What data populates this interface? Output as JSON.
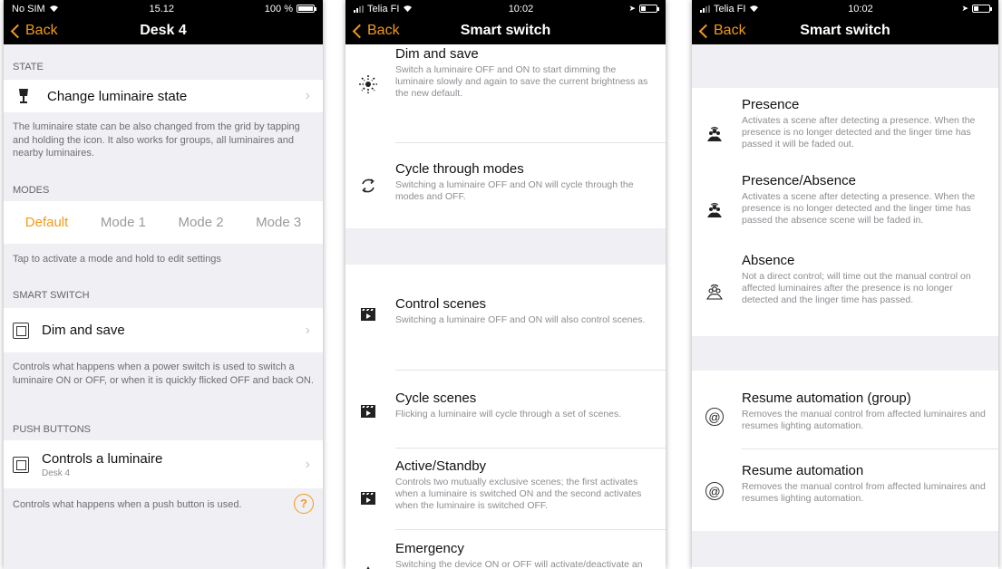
{
  "panel1": {
    "status": {
      "carrier": "No SIM",
      "time": "15.12",
      "battery": "100 %"
    },
    "nav": {
      "back": "Back",
      "title": "Desk 4"
    },
    "state_header": "STATE",
    "state_cell": "Change luminaire state",
    "state_note": "The luminaire state can be also changed from the grid by tapping and holding the icon. It also works for groups, all luminaires and nearby luminaires.",
    "modes_header": "MODES",
    "modes": [
      "Default",
      "Mode 1",
      "Mode 2",
      "Mode 3"
    ],
    "modes_note": "Tap to activate a mode and hold to edit settings",
    "smart_header": "SMART SWITCH",
    "smart_cell": "Dim and save",
    "smart_note": "Controls what happens when a power switch is used to switch a luminaire ON or OFF, or when it is quickly flicked OFF and back ON.",
    "push_header": "PUSH BUTTONS",
    "push_cell": "Controls a luminaire",
    "push_sub": "Desk 4",
    "push_note": "Controls what happens when a push button is used.",
    "help": "?"
  },
  "panel2": {
    "status": {
      "carrier": "Telia FI",
      "time": "10:02"
    },
    "nav": {
      "back": "Back",
      "title": "Smart switch"
    },
    "items": [
      {
        "title": "Dim and save",
        "desc": "Switch a luminaire OFF and ON to start dimming the luminaire slowly and again to save the current brightness as the new default."
      },
      {
        "title": "Cycle through modes",
        "desc": "Switching a luminaire OFF and ON will cycle through the modes and OFF."
      },
      {
        "title": "Control scenes",
        "desc": "Switching a luminaire OFF and ON will also control scenes."
      },
      {
        "title": "Cycle scenes",
        "desc": "Flicking a luminaire will cycle through a set of scenes."
      },
      {
        "title": "Active/Standby",
        "desc": "Controls two mutually exclusive scenes; the first activates when a luminaire is switched ON and the second activates when the luminaire is switched OFF."
      },
      {
        "title": "Emergency",
        "desc": "Switching the device ON or OFF will activate/deactivate an emergency scene"
      }
    ]
  },
  "panel3": {
    "status": {
      "carrier": "Telia FI",
      "time": "10:02"
    },
    "nav": {
      "back": "Back",
      "title": "Smart switch"
    },
    "items": [
      {
        "title": "Presence",
        "desc": "Activates a scene after detecting a presence. When the presence is no longer detected and the linger time has passed it will be faded out."
      },
      {
        "title": "Presence/Absence",
        "desc": "Activates a scene after detecting a presence. When the presence is no longer detected and the linger time has passed the absence scene will be faded in."
      },
      {
        "title": "Absence",
        "desc": "Not a direct control; will time out the manual control on affected luminaires after the presence is no longer detected and the linger time has passed."
      },
      {
        "title": "Resume automation (group)",
        "desc": "Removes the manual control from affected luminaires and resumes lighting automation."
      },
      {
        "title": "Resume automation",
        "desc": "Removes the manual control from affected luminaires and resumes lighting automation."
      }
    ],
    "at_symbol": "@"
  },
  "colors": {
    "accent": "#f29a1b",
    "bar": "#000000",
    "grouped_bg": "#efeff4"
  }
}
